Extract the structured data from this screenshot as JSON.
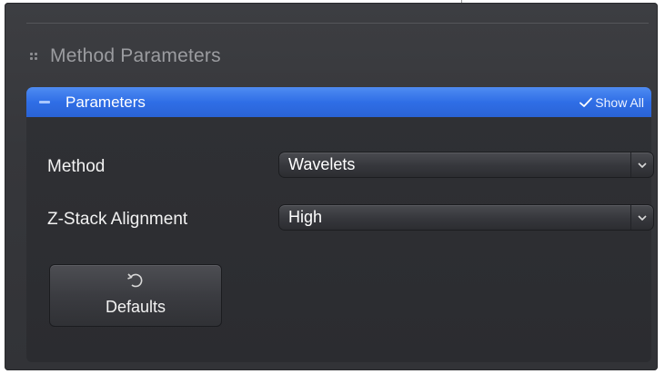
{
  "section": {
    "title": "Method Parameters",
    "grip_icon": "grip-dots-icon"
  },
  "group": {
    "title": "Parameters",
    "collapse_icon": "minus-icon",
    "show_all_label": "Show All",
    "show_all_icon": "check-icon",
    "accent_color": "#2f6ee6"
  },
  "fields": {
    "method": {
      "label": "Method",
      "value": "Wavelets",
      "icon": "chevron-down-icon"
    },
    "zstack": {
      "label": "Z-Stack Alignment",
      "value": "High",
      "icon": "chevron-down-icon"
    }
  },
  "defaults_button": {
    "label": "Defaults",
    "icon": "undo-icon"
  }
}
